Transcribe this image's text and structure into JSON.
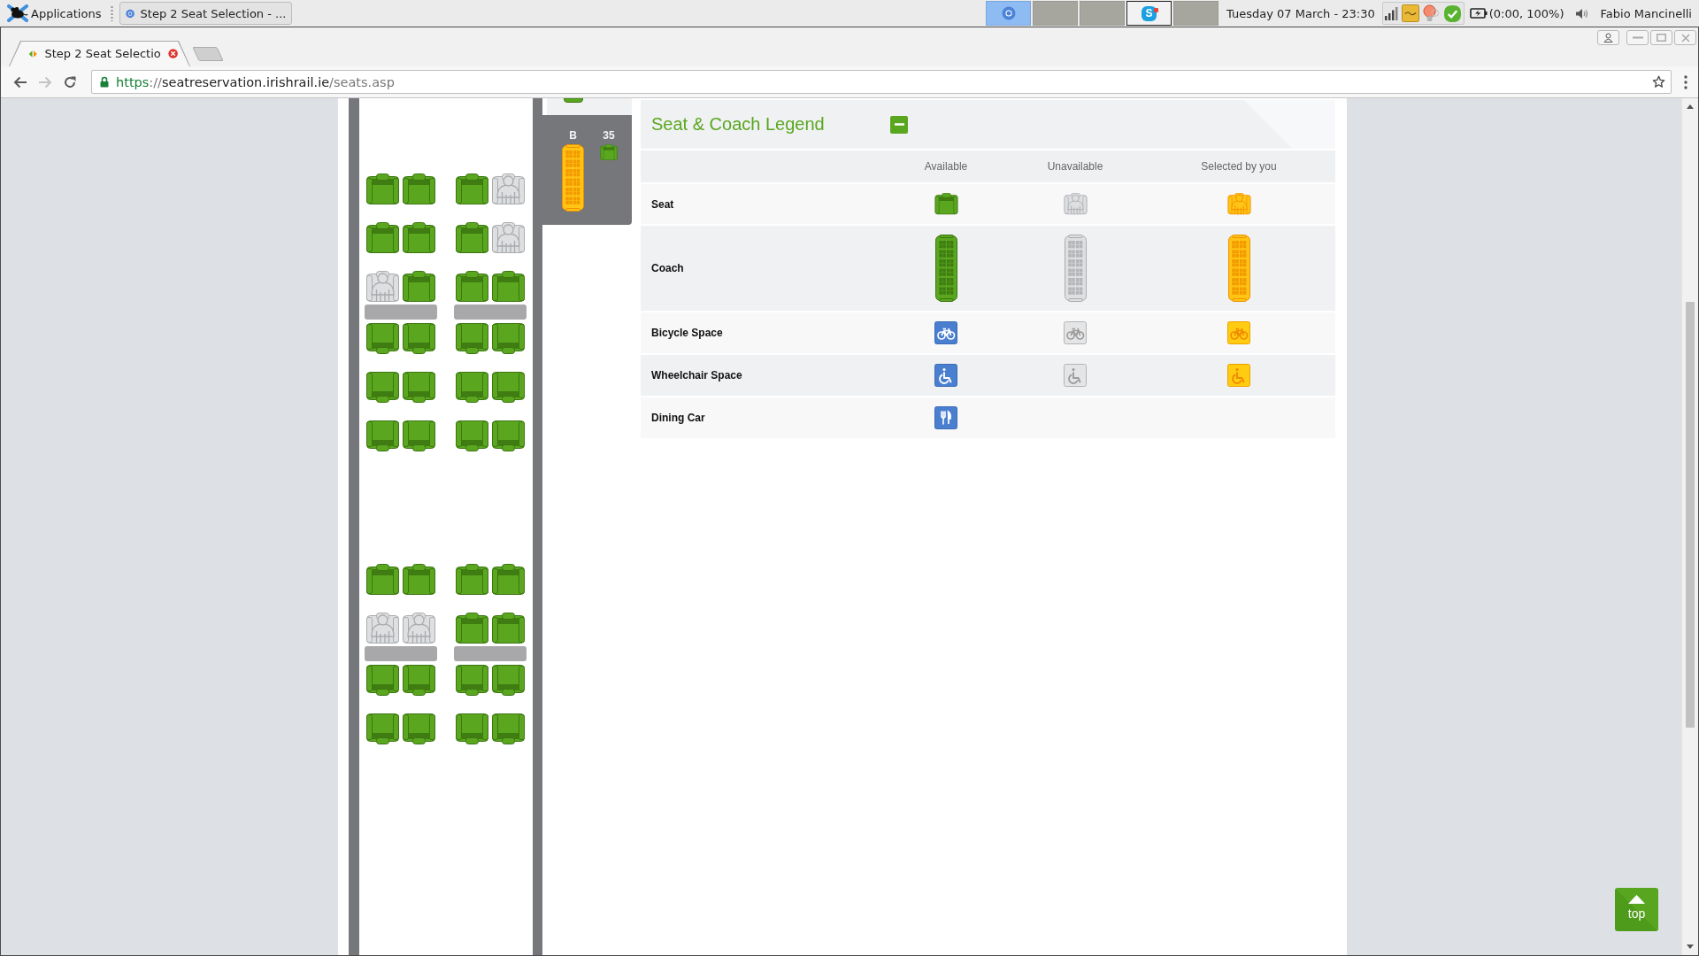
{
  "taskbar": {
    "menu_label": "Applications",
    "windows": [
      {
        "title": "Step 2 Seat Selection - ..."
      }
    ],
    "workspaces": [
      {
        "kind": "browser",
        "selected": true,
        "urgent": false
      },
      {
        "kind": "empty",
        "selected": false,
        "urgent": false
      },
      {
        "kind": "empty",
        "selected": false,
        "urgent": false
      },
      {
        "kind": "chat",
        "app_letter": "S",
        "selected": false,
        "urgent": true
      },
      {
        "kind": "empty",
        "selected": false,
        "urgent": false
      }
    ],
    "clock": "Tuesday 07 March - 23:30",
    "battery": "(0:00, 100%)",
    "user": "Fabio Mancinelli"
  },
  "browser": {
    "tabs": [
      {
        "title": "Step 2 Seat Selectio",
        "selected": true
      }
    ],
    "nav_buttons": [
      {
        "kind": "back",
        "disabled": false
      },
      {
        "kind": "forward",
        "disabled": true
      },
      {
        "kind": "reload",
        "disabled": false
      }
    ],
    "url": {
      "scheme": "https",
      "separator": "://",
      "host": "seatreservation.irishrail.ie",
      "path": "/seats.asp"
    }
  },
  "seat_map": {
    "sections": [
      {
        "rows": [
          {
            "kind": "forward",
            "seats": [
              {
                "available": true
              },
              {
                "available": true
              },
              {
                "available": true
              },
              {
                "available": false
              }
            ]
          },
          {
            "kind": "forward",
            "seats": [
              {
                "available": true
              },
              {
                "available": true
              },
              {
                "available": true
              },
              {
                "available": false
              }
            ]
          },
          {
            "kind": "forward",
            "seats": [
              {
                "available": false
              },
              {
                "available": true
              },
              {
                "available": true
              },
              {
                "available": true
              }
            ]
          },
          {
            "kind": "table"
          },
          {
            "kind": "backward",
            "seats": [
              {
                "available": true
              },
              {
                "available": true
              },
              {
                "available": true
              },
              {
                "available": true
              }
            ]
          },
          {
            "kind": "backward",
            "seats": [
              {
                "available": true
              },
              {
                "available": true
              },
              {
                "available": true
              },
              {
                "available": true
              }
            ]
          },
          {
            "kind": "backward",
            "seats": [
              {
                "available": true
              },
              {
                "available": true
              },
              {
                "available": true
              },
              {
                "available": true
              }
            ]
          }
        ]
      },
      {
        "rows": [
          {
            "kind": "forward",
            "seats": [
              {
                "available": true
              },
              {
                "available": true
              },
              {
                "available": true
              },
              {
                "available": true
              }
            ]
          },
          {
            "kind": "forward",
            "seats": [
              {
                "available": false
              },
              {
                "available": false
              },
              {
                "available": true
              },
              {
                "available": true
              }
            ]
          },
          {
            "kind": "table"
          },
          {
            "kind": "backward",
            "seats": [
              {
                "available": true
              },
              {
                "available": true
              },
              {
                "available": true
              },
              {
                "available": true
              }
            ]
          },
          {
            "kind": "backward",
            "seats": [
              {
                "available": true
              },
              {
                "available": true
              },
              {
                "available": true
              },
              {
                "available": true
              }
            ]
          }
        ]
      }
    ]
  },
  "coach_list": [
    {
      "kind": "available",
      "current": true
    },
    {
      "kind": "selected",
      "label": "B",
      "seat_count": "35",
      "current": false
    }
  ],
  "legend": {
    "title": "Seat & Coach Legend",
    "expanded": true,
    "columns": [
      "Available",
      "Unavailable",
      "Selected by you"
    ],
    "rows": [
      {
        "label": "Seat",
        "kind": "seat",
        "cells": [
          {
            "kind": "available"
          },
          {
            "kind": "unavailable"
          },
          {
            "kind": "selected"
          }
        ]
      },
      {
        "label": "Coach",
        "kind": "coach",
        "cells": [
          {
            "kind": "available"
          },
          {
            "kind": "unavailable"
          },
          {
            "kind": "selected"
          }
        ]
      },
      {
        "label": "Bicycle Space",
        "kind": "bicycle",
        "cells": [
          {
            "kind": "available"
          },
          {
            "kind": "unavailable"
          },
          {
            "kind": "selected"
          }
        ]
      },
      {
        "label": "Wheelchair Space",
        "kind": "wheelchair",
        "cells": [
          {
            "kind": "available"
          },
          {
            "kind": "unavailable"
          },
          {
            "kind": "selected"
          }
        ]
      },
      {
        "label": "Dining Car",
        "kind": "dining",
        "cells": [
          {
            "kind": "available"
          }
        ]
      }
    ]
  },
  "scroll_top": {
    "label": "top"
  }
}
